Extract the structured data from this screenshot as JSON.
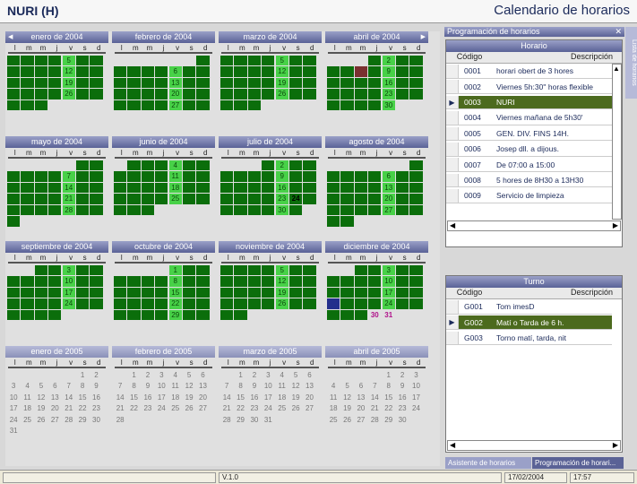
{
  "header": {
    "title": "NURI (H)",
    "app_title": "Calendario de horarios"
  },
  "weekdays": [
    "l",
    "m",
    "m",
    "j",
    "v",
    "s",
    "d"
  ],
  "months": [
    {
      "name": "enero de 2004",
      "off": 0,
      "cells": [
        "",
        "",
        "",
        "g",
        "l",
        "g",
        "g",
        "g",
        "l",
        "g",
        "g",
        "l",
        "g",
        "g",
        "g",
        "g",
        "g",
        "g",
        "l",
        "g",
        "g",
        "g",
        "g",
        "g",
        "g",
        "l",
        "g",
        "g",
        "g",
        "g",
        "g",
        "g",
        "l",
        "g",
        "g",
        "g",
        "g",
        "g",
        "g",
        "l"
      ],
      "nums": {
        "1": "31"
      }
    },
    {
      "name": "febrero de 2004",
      "off": 6,
      "cells": [
        "",
        "",
        "",
        "",
        "",
        "",
        "g",
        "g",
        "g",
        "g",
        "g",
        "l",
        "g",
        "g",
        "g",
        "g",
        "g",
        "g",
        "l",
        "g",
        "g",
        "g",
        "g",
        "g",
        "g",
        "l",
        "g",
        "g",
        "g",
        "g",
        "g",
        "g",
        "l",
        "g",
        "g"
      ],
      "nums": {}
    },
    {
      "name": "marzo de 2004",
      "off": 0,
      "cells": [
        "g",
        "g",
        "g",
        "g",
        "l",
        "g",
        "g",
        "g",
        "g",
        "g",
        "g",
        "l",
        "g",
        "g",
        "g",
        "g",
        "g",
        "g",
        "l",
        "g",
        "g",
        "g",
        "g",
        "g",
        "g",
        "l",
        "g",
        "g",
        "g",
        "g",
        "g",
        "g",
        "g"
      ],
      "nums": {}
    },
    {
      "name": "abril de 2004",
      "off": 3,
      "cells": [
        "",
        "",
        "",
        "g",
        "l",
        "g",
        "g",
        "g",
        "g",
        "g",
        "g",
        "l",
        "g",
        "g",
        "g",
        "g",
        "g",
        "g",
        "l",
        "g",
        "g",
        "g",
        "g",
        "g",
        "g",
        "l",
        "g",
        "g",
        "g",
        "g",
        "g",
        "g",
        "l"
      ],
      "nums": {}
    },
    {
      "name": "mayo de 2004",
      "off": 5,
      "cells": [
        "",
        "",
        "",
        "",
        "",
        "g",
        "g",
        "g",
        "g",
        "g",
        "g",
        "l",
        "g",
        "g",
        "g",
        "g",
        "g",
        "g",
        "l",
        "g",
        "g",
        "g",
        "g",
        "g",
        "g",
        "l",
        "g",
        "g",
        "g",
        "g",
        "g",
        "g",
        "l",
        "g",
        "g",
        "g",
        "g",
        "g"
      ],
      "nums": {}
    },
    {
      "name": "junio de 2004",
      "off": 1,
      "cells": [
        "",
        "g",
        "g",
        "g",
        "l",
        "g",
        "g",
        "g",
        "g",
        "g",
        "g",
        "l",
        "g",
        "g",
        "g",
        "g",
        "g",
        "g",
        "l",
        "g",
        "g",
        "g",
        "g",
        "g",
        "g",
        "l",
        "g",
        "g",
        "g",
        "g"
      ],
      "nums": {}
    },
    {
      "name": "julio de 2004",
      "off": 3,
      "cells": [
        "",
        "",
        "",
        "g",
        "l",
        "g",
        "g",
        "g",
        "g",
        "g",
        "g",
        "l",
        "g",
        "g",
        "g",
        "g",
        "g",
        "g",
        "l",
        "g",
        "g",
        "g",
        "g",
        "g",
        "g",
        "l",
        "g",
        "g",
        "g",
        "g",
        "g",
        "g",
        "l",
        "g",
        "g"
      ],
      "nums": {}
    },
    {
      "name": "agosto de 2004",
      "off": 6,
      "cells": [
        "",
        "",
        "",
        "",
        "",
        "",
        "g",
        "g",
        "g",
        "g",
        "g",
        "l",
        "g",
        "g",
        "g",
        "g",
        "g",
        "g",
        "l",
        "g",
        "g",
        "g",
        "g",
        "g",
        "g",
        "l",
        "g",
        "g",
        "g",
        "g",
        "g",
        "g",
        "l",
        "g",
        "g"
      ],
      "nums": {}
    },
    {
      "name": "septiembre de 2004",
      "off": 2,
      "cells": [
        "",
        "",
        "g",
        "l",
        "g",
        "g",
        "g",
        "g",
        "g",
        "g",
        "l",
        "g",
        "g",
        "g",
        "g",
        "g",
        "g",
        "l",
        "g",
        "g",
        "g",
        "g",
        "g",
        "g",
        "l",
        "g",
        "g",
        "g",
        "g",
        "g",
        "g",
        "l",
        "g"
      ],
      "nums": {}
    },
    {
      "name": "octubre de 2004",
      "off": 4,
      "cells": [
        "",
        "",
        "",
        "",
        "l",
        "g",
        "g",
        "g",
        "g",
        "g",
        "g",
        "l",
        "g",
        "g",
        "g",
        "g",
        "g",
        "g",
        "l",
        "g",
        "g",
        "g",
        "g",
        "g",
        "g",
        "l",
        "g",
        "g",
        "g",
        "g",
        "g",
        "g",
        "l",
        "g",
        "g"
      ],
      "nums": {}
    },
    {
      "name": "noviembre de 2004",
      "off": 0,
      "cells": [
        "g",
        "g",
        "g",
        "g",
        "l",
        "g",
        "g",
        "g",
        "g",
        "g",
        "g",
        "l",
        "g",
        "g",
        "g",
        "g",
        "g",
        "g",
        "l",
        "g",
        "g",
        "g",
        "g",
        "g",
        "g",
        "l",
        "g",
        "g",
        "g",
        "g"
      ],
      "nums": {}
    },
    {
      "name": "diciembre de 2004",
      "off": 2,
      "cells": [
        "",
        "",
        "g",
        "g",
        "g",
        "g",
        "g",
        "g",
        "g",
        "g",
        "l",
        "g",
        "g",
        "g",
        "g",
        "g",
        "g",
        "l",
        "g",
        "g",
        "g",
        "b",
        "g",
        "g",
        "l",
        "g",
        "g",
        "g",
        "g",
        "g",
        "g",
        "p",
        "p"
      ],
      "nums": {}
    },
    {
      "name": "enero de 2005",
      "off": 5,
      "cells": [],
      "nums": {}
    },
    {
      "name": "febrero de 2005",
      "off": 1,
      "cells": [],
      "nums": {}
    },
    {
      "name": "marzo de 2005",
      "off": 1,
      "cells": [],
      "nums": {}
    },
    {
      "name": "abril de 2005",
      "off": 4,
      "cells": [],
      "nums": {}
    }
  ],
  "horario": {
    "tab": "Programación de horarios",
    "title": "Horario",
    "col_code": "Código",
    "col_desc": "Descripción",
    "rows": [
      {
        "code": "0001",
        "desc": "horari obert de 3 hores"
      },
      {
        "code": "0002",
        "desc": "Viernes 5h:30'' horas flexible"
      },
      {
        "code": "0003",
        "desc": "NURI",
        "sel": true
      },
      {
        "code": "0004",
        "desc": "Viernes mañana de 5h30'"
      },
      {
        "code": "0005",
        "desc": "GEN. DIV. FINS 14H."
      },
      {
        "code": "0006",
        "desc": "Josep dll. a dijous."
      },
      {
        "code": "0007",
        "desc": "De 07:00 a 15:00"
      },
      {
        "code": "0008",
        "desc": "5 hores de 8H30 a 13H30"
      },
      {
        "code": "0009",
        "desc": "Servicio de limpieza"
      }
    ]
  },
  "turno": {
    "title": "Turno",
    "col_code": "Código",
    "col_desc": "Descripción",
    "rows": [
      {
        "code": "G001",
        "desc": "Tom imesD"
      },
      {
        "code": "G002",
        "desc": "Matí o Tarda de 6 h.",
        "sel": true
      },
      {
        "code": "G003",
        "desc": "Torno matí, tarda, nit"
      }
    ]
  },
  "tabs": {
    "asistente": "Asistente de horarios",
    "programacion": "Programación de horari..."
  },
  "side_tab": "Lista de horarios",
  "status": {
    "version": "V.1.0",
    "date": "17/02/2004",
    "time": "17:57"
  }
}
